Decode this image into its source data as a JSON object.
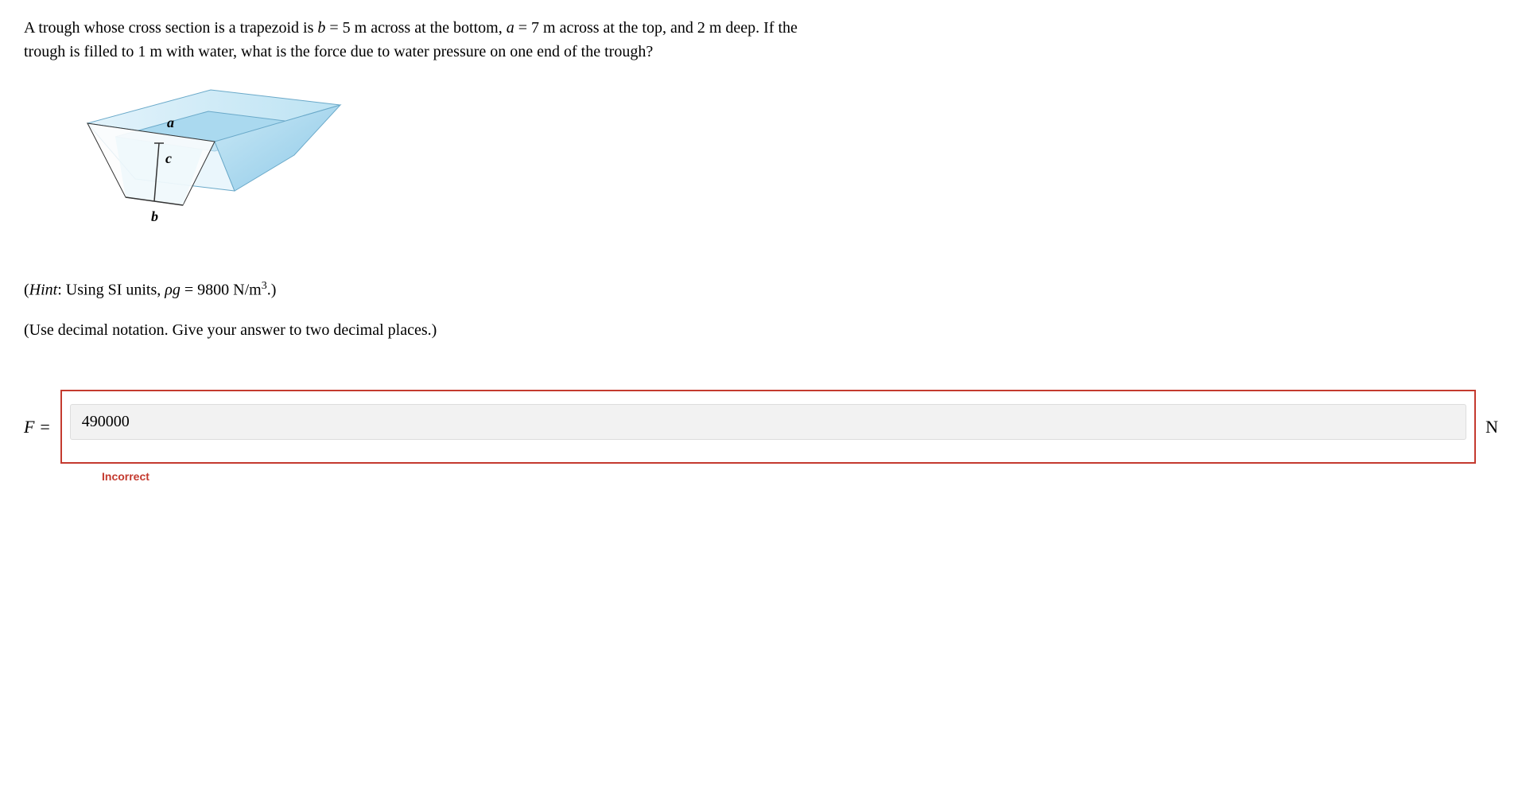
{
  "question": {
    "part1": "A trough whose cross section is a trapezoid is ",
    "var_b": "b",
    "eq1": " = 5 m across at the bottom, ",
    "var_a": "a",
    "eq2": " = 7 m across at the top, and 2 m deep. If the",
    "line2": "trough is filled to 1 m with water, what is the force due to water pressure on one end of the trough?"
  },
  "diagram": {
    "label_a": "a",
    "label_b": "b",
    "label_c": "c"
  },
  "hint": {
    "prefix": "(",
    "hint_word": "Hint",
    "text": ": Using SI units, ",
    "var_rho": "ρg",
    "value": " = 9800 N/m",
    "sup": "3",
    "suffix": ".)"
  },
  "instruction": "(Use decimal notation. Give your answer to two decimal places.)",
  "answer": {
    "label": "F =",
    "value": "490000",
    "unit": "N",
    "feedback": "Incorrect"
  }
}
